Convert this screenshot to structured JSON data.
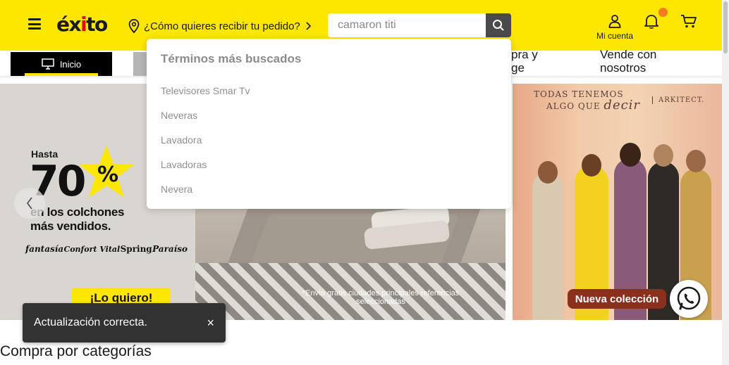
{
  "header": {
    "logo_text": "éxito",
    "delivery_prompt": "¿Cómo quieres recibir tu pedido?",
    "account_label": "Mi cuenta"
  },
  "search": {
    "value": "camaron titi",
    "placeholder": ""
  },
  "nav": {
    "home_label": "Inicio",
    "links": [
      "pra y\nge",
      "Vende con\nnosotros"
    ]
  },
  "dropdown": {
    "title": "Términos más buscados",
    "items": [
      "Televisores Smar Tv",
      "Neveras",
      "Lavadora",
      "Lavadoras",
      "Nevera"
    ]
  },
  "banner_left": {
    "hasta": "Hasta",
    "big_number": "70",
    "percent": "%",
    "line1": "en los colchones",
    "line2": "más vendidos.",
    "brands": [
      "fantasía",
      "Confort Vital",
      "Spring",
      "Paraíso"
    ],
    "cta": "¡Lo quiero!",
    "disclaimer": "*Envío gratis ciudades principales referencias seleccionadas"
  },
  "banner_right": {
    "headline_1": "TODAS TENEMOS",
    "headline_2": "ALGO QUE",
    "headline_3": "decir",
    "brand": "ARKITECT.",
    "cta": "Nueva colección"
  },
  "toast": {
    "message": "Actualización correcta.",
    "close": "×"
  },
  "section": {
    "title": "Compra por categorías"
  },
  "colors": {
    "brand_yellow": "#fde600",
    "notification_dot": "#f47b20",
    "toast_bg": "#323232"
  },
  "icons": [
    "menu-icon",
    "location-pin-icon",
    "chevron-right-icon",
    "search-icon",
    "user-icon",
    "bell-icon",
    "cart-icon",
    "monitor-icon",
    "chevron-left-icon",
    "whatsapp-icon",
    "close-icon"
  ]
}
